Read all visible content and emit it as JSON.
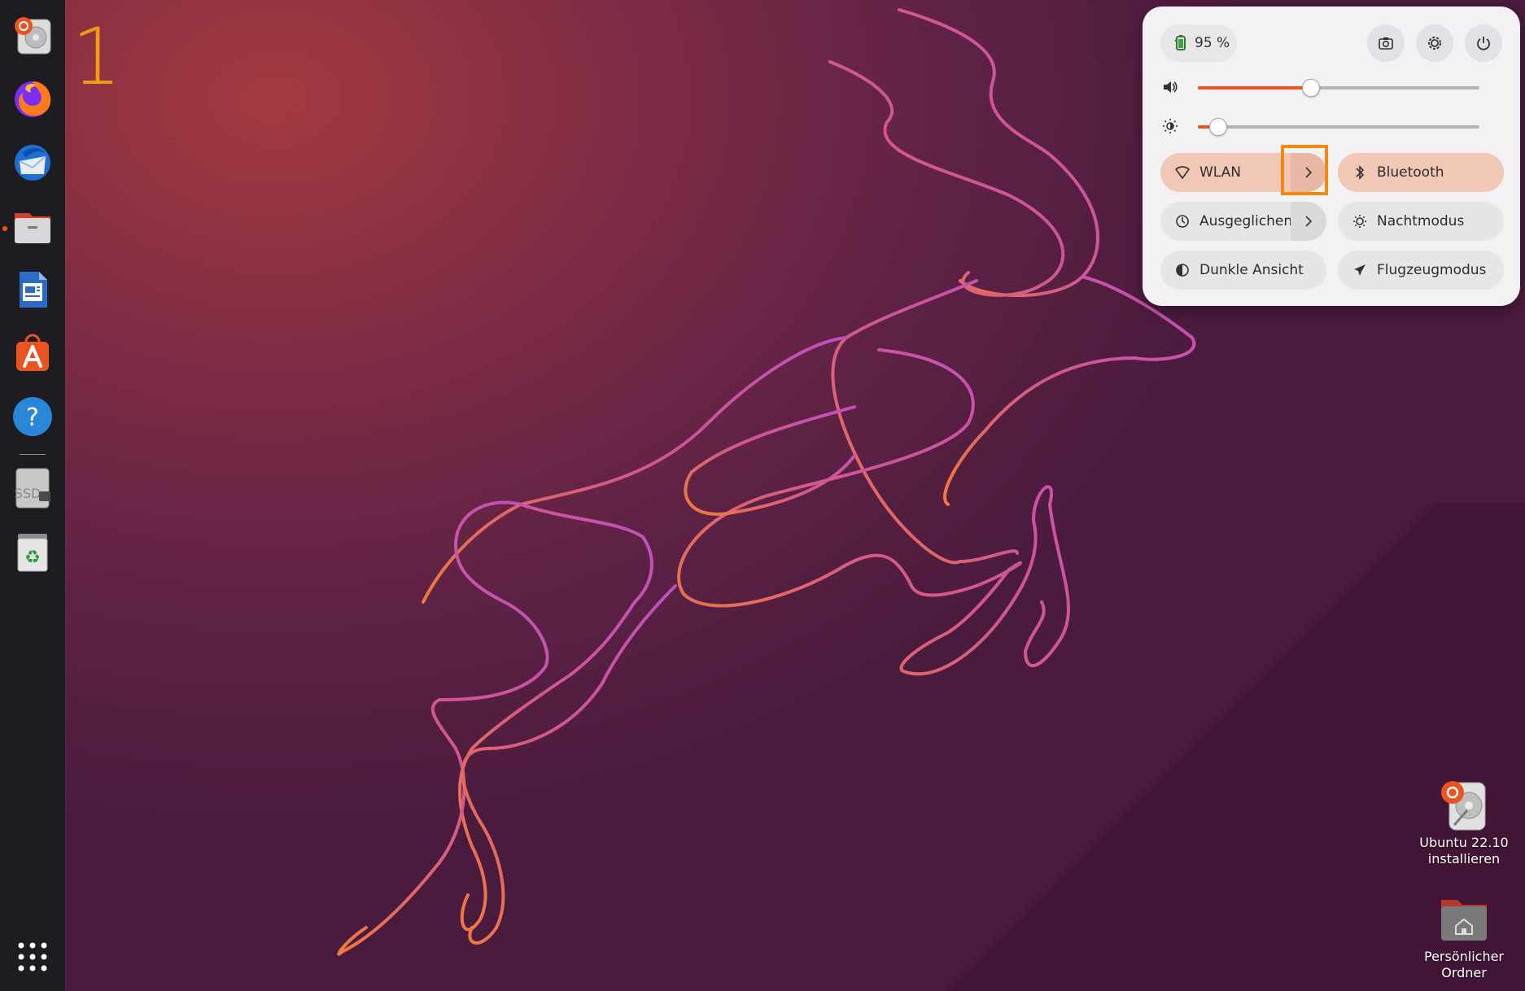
{
  "workspace": {
    "number": "1"
  },
  "dock": {
    "items": [
      {
        "name": "Ubuntu Installer",
        "icon": "installer-icon"
      },
      {
        "name": "Firefox",
        "icon": "firefox-icon"
      },
      {
        "name": "Thunderbird",
        "icon": "thunderbird-icon"
      },
      {
        "name": "Files",
        "icon": "files-icon"
      },
      {
        "name": "LibreOffice Writer",
        "icon": "writer-icon"
      },
      {
        "name": "Ubuntu Software",
        "icon": "software-icon"
      },
      {
        "name": "Help",
        "icon": "help-icon"
      },
      {
        "name": "SSD",
        "icon": "drive-icon",
        "label": "SSD"
      },
      {
        "name": "Trash",
        "icon": "trash-icon"
      },
      {
        "name": "Show Applications",
        "icon": "app-grid-icon"
      }
    ]
  },
  "quick_settings": {
    "battery": {
      "label": "95 %",
      "level": 0.95
    },
    "volume": {
      "level": 0.4
    },
    "brightness": {
      "level": 0.07
    },
    "toggles": [
      {
        "label": "WLAN",
        "active": true,
        "has_arrow": true,
        "icon": "wifi-icon"
      },
      {
        "label": "Bluetooth",
        "active": true,
        "has_arrow": false,
        "icon": "bluetooth-icon"
      },
      {
        "label": "Ausgeglichen",
        "active": false,
        "has_arrow": true,
        "icon": "power-profile-icon"
      },
      {
        "label": "Nachtmodus",
        "active": false,
        "has_arrow": false,
        "icon": "night-light-icon"
      },
      {
        "label": "Dunkle Ansicht",
        "active": false,
        "has_arrow": false,
        "icon": "dark-mode-icon"
      },
      {
        "label": "Flugzeugmodus",
        "active": false,
        "has_arrow": false,
        "icon": "airplane-icon"
      }
    ],
    "buttons": [
      {
        "icon": "screenshot-icon"
      },
      {
        "icon": "settings-icon"
      },
      {
        "icon": "power-icon"
      }
    ]
  },
  "desktop_icons": [
    {
      "label_line1": "Ubuntu 22.10",
      "label_line2": "installieren",
      "icon": "installer-icon"
    },
    {
      "label_line1": "Persönlicher",
      "label_line2": "Ordner",
      "icon": "home-folder-icon"
    }
  ],
  "colors": {
    "accent": "#e95420",
    "highlight": "#f28a12",
    "panel_bg": "#f3f1f4",
    "toggle_on": "#f1c7b6"
  }
}
